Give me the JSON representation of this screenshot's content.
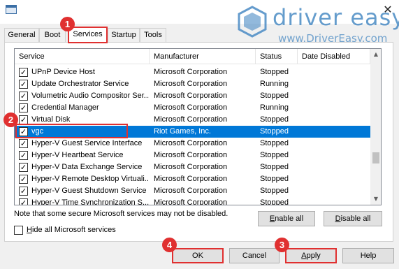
{
  "window": {
    "icon": "window-icon",
    "close_glyph": "✕"
  },
  "watermark": {
    "brand": "driver easy",
    "url": "www.DriverEasy.com"
  },
  "tabs": [
    {
      "label": "General"
    },
    {
      "label": "Boot"
    },
    {
      "label": "Services"
    },
    {
      "label": "Startup"
    },
    {
      "label": "Tools"
    }
  ],
  "columns": [
    "Service",
    "Manufacturer",
    "Status",
    "Date Disabled"
  ],
  "rows": [
    {
      "service": "UPnP Device Host",
      "manufacturer": "Microsoft Corporation",
      "status": "Stopped",
      "checked": true
    },
    {
      "service": "Update Orchestrator Service",
      "manufacturer": "Microsoft Corporation",
      "status": "Running",
      "checked": true
    },
    {
      "service": "Volumetric Audio Compositor Ser...",
      "manufacturer": "Microsoft Corporation",
      "status": "Stopped",
      "checked": true
    },
    {
      "service": "Credential Manager",
      "manufacturer": "Microsoft Corporation",
      "status": "Running",
      "checked": true
    },
    {
      "service": "Virtual Disk",
      "manufacturer": "Microsoft Corporation",
      "status": "Stopped",
      "checked": true
    },
    {
      "service": "vgc",
      "manufacturer": "Riot Games, Inc.",
      "status": "Stopped",
      "checked": true,
      "selected": true
    },
    {
      "service": "Hyper-V Guest Service Interface",
      "manufacturer": "Microsoft Corporation",
      "status": "Stopped",
      "checked": true
    },
    {
      "service": "Hyper-V Heartbeat Service",
      "manufacturer": "Microsoft Corporation",
      "status": "Stopped",
      "checked": true
    },
    {
      "service": "Hyper-V Data Exchange Service",
      "manufacturer": "Microsoft Corporation",
      "status": "Stopped",
      "checked": true
    },
    {
      "service": "Hyper-V Remote Desktop Virtuali...",
      "manufacturer": "Microsoft Corporation",
      "status": "Stopped",
      "checked": true
    },
    {
      "service": "Hyper-V Guest Shutdown Service",
      "manufacturer": "Microsoft Corporation",
      "status": "Stopped",
      "checked": true
    },
    {
      "service": "Hyper-V Time Synchronization S...",
      "manufacturer": "Microsoft Corporation",
      "status": "Stopped",
      "checked": true
    }
  ],
  "check_glyph": "✓",
  "note": "Note that some secure Microsoft services may not be disabled.",
  "buttons": {
    "enable_all": {
      "u": "E",
      "rest": "nable all"
    },
    "disable_all": {
      "u": "D",
      "rest": "isable all"
    },
    "ok": "OK",
    "cancel": "Cancel",
    "apply": {
      "u": "A",
      "rest": "pply"
    },
    "help": "Help"
  },
  "hide_ms": {
    "u": "H",
    "rest": "ide all Microsoft services",
    "checked": false
  },
  "steps": [
    "1",
    "2",
    "3",
    "4"
  ],
  "colors": {
    "accent": "#e03030",
    "selection": "#0078d7"
  }
}
